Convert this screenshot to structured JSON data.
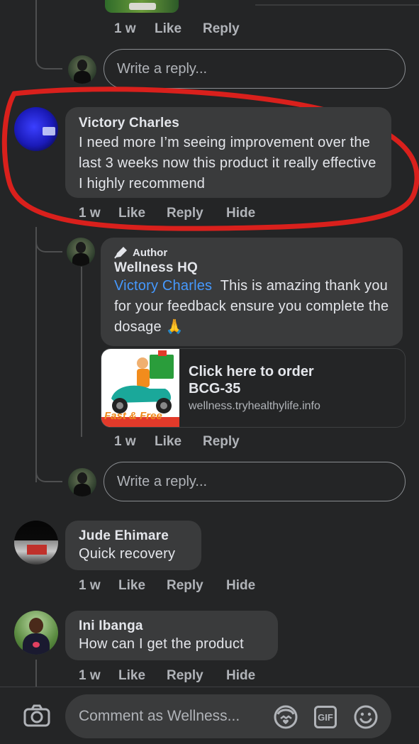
{
  "top_comment": {
    "meta": {
      "time": "1 w",
      "like": "Like",
      "reply": "Reply"
    },
    "write_reply_placeholder": "Write a reply..."
  },
  "comment_victory": {
    "author": "Victory Charles",
    "text": "I need more I’m seeing improvement over the last 3 weeks now this product it really effective I highly recommend",
    "meta": {
      "time": "1 w",
      "like": "Like",
      "reply": "Reply",
      "hide": "Hide"
    }
  },
  "reply_author": {
    "badge": "Author",
    "author": "Wellness HQ",
    "mention": "Victory Charles",
    "text": "This is amazing thank you for your feedback ensure you complete the dosage 🙏",
    "link": {
      "title": "Click here to order BCG-35",
      "domain": "wellness.tryhealthylife.info",
      "thumb_text": "Fast & Free"
    },
    "meta": {
      "time": "1 w",
      "like": "Like",
      "reply": "Reply"
    },
    "write_reply_placeholder": "Write a reply..."
  },
  "comment_jude": {
    "author": "Jude Ehimare",
    "text": "Quick recovery",
    "meta": {
      "time": "1 w",
      "like": "Like",
      "reply": "Reply",
      "hide": "Hide"
    }
  },
  "comment_ini": {
    "author": "Ini Ibanga",
    "text": "How can I get the product",
    "meta": {
      "time": "1 w",
      "like": "Like",
      "reply": "Reply",
      "hide": "Hide"
    }
  },
  "composer": {
    "placeholder": "Comment as Wellness...",
    "gif_label": "GIF"
  },
  "colors": {
    "background": "#242526",
    "bubble": "#3a3b3c",
    "mention": "#4599ff",
    "highlight": "#d9201c"
  }
}
